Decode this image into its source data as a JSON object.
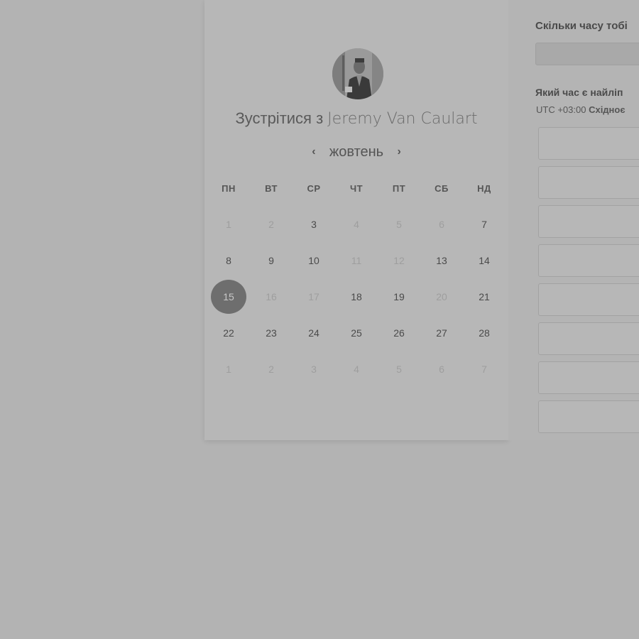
{
  "header": {
    "meet_prefix": "Зустрітися з",
    "host_name": "Jeremy Van Caulart"
  },
  "calendar": {
    "month": "жовтень",
    "prev_icon": "chevron-left-icon",
    "next_icon": "chevron-right-icon",
    "weekdays": [
      "ПН",
      "ВТ",
      "СР",
      "ЧТ",
      "ПТ",
      "СБ",
      "НД"
    ],
    "days": [
      {
        "label": "1",
        "state": "disabled"
      },
      {
        "label": "2",
        "state": "disabled"
      },
      {
        "label": "3",
        "state": "available"
      },
      {
        "label": "4",
        "state": "disabled"
      },
      {
        "label": "5",
        "state": "disabled"
      },
      {
        "label": "6",
        "state": "disabled"
      },
      {
        "label": "7",
        "state": "available"
      },
      {
        "label": "8",
        "state": "available"
      },
      {
        "label": "9",
        "state": "available"
      },
      {
        "label": "10",
        "state": "available"
      },
      {
        "label": "11",
        "state": "disabled"
      },
      {
        "label": "12",
        "state": "disabled"
      },
      {
        "label": "13",
        "state": "available"
      },
      {
        "label": "14",
        "state": "available"
      },
      {
        "label": "15",
        "state": "selected"
      },
      {
        "label": "16",
        "state": "disabled"
      },
      {
        "label": "17",
        "state": "disabled"
      },
      {
        "label": "18",
        "state": "available"
      },
      {
        "label": "19",
        "state": "available"
      },
      {
        "label": "20",
        "state": "disabled"
      },
      {
        "label": "21",
        "state": "available"
      },
      {
        "label": "22",
        "state": "available"
      },
      {
        "label": "23",
        "state": "available"
      },
      {
        "label": "24",
        "state": "available"
      },
      {
        "label": "25",
        "state": "available"
      },
      {
        "label": "26",
        "state": "available"
      },
      {
        "label": "27",
        "state": "available"
      },
      {
        "label": "28",
        "state": "available"
      },
      {
        "label": "1",
        "state": "disabled"
      },
      {
        "label": "2",
        "state": "disabled"
      },
      {
        "label": "3",
        "state": "disabled"
      },
      {
        "label": "4",
        "state": "disabled"
      },
      {
        "label": "5",
        "state": "disabled"
      },
      {
        "label": "6",
        "state": "disabled"
      },
      {
        "label": "7",
        "state": "disabled"
      }
    ]
  },
  "right_panel": {
    "duration_label": "Скільки часу тобі",
    "time_label": "Який час є найліп",
    "tz_offset": "UTC +03:00",
    "tz_name": "Східноє",
    "slot_count": 8
  },
  "colors": {
    "overlay": "#b3b3b3",
    "selected_day": "#6e6e6e"
  }
}
